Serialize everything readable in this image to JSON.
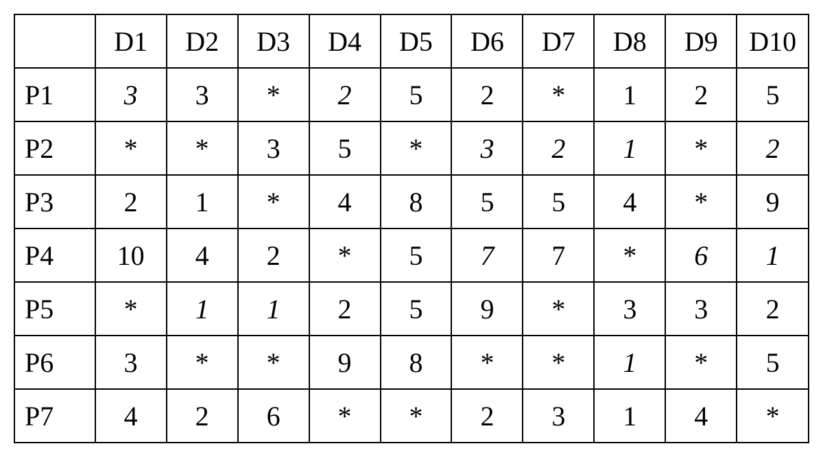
{
  "chart_data": {
    "type": "table",
    "columns": [
      "",
      "D1",
      "D2",
      "D3",
      "D4",
      "D5",
      "D6",
      "D7",
      "D8",
      "D9",
      "D10"
    ],
    "rows": [
      {
        "label": "P1",
        "cells": [
          {
            "v": "3",
            "italic": true
          },
          {
            "v": "3",
            "italic": false
          },
          {
            "v": "*",
            "italic": false
          },
          {
            "v": "2",
            "italic": true
          },
          {
            "v": "5",
            "italic": false
          },
          {
            "v": "2",
            "italic": false
          },
          {
            "v": "*",
            "italic": false
          },
          {
            "v": "1",
            "italic": false
          },
          {
            "v": "2",
            "italic": false
          },
          {
            "v": "5",
            "italic": false
          }
        ]
      },
      {
        "label": "P2",
        "cells": [
          {
            "v": "*",
            "italic": false
          },
          {
            "v": "*",
            "italic": false
          },
          {
            "v": "3",
            "italic": false
          },
          {
            "v": "5",
            "italic": false
          },
          {
            "v": "*",
            "italic": false
          },
          {
            "v": "3",
            "italic": true
          },
          {
            "v": "2",
            "italic": true
          },
          {
            "v": "1",
            "italic": true
          },
          {
            "v": "*",
            "italic": false
          },
          {
            "v": "2",
            "italic": true
          }
        ]
      },
      {
        "label": "P3",
        "cells": [
          {
            "v": "2",
            "italic": false
          },
          {
            "v": "1",
            "italic": false
          },
          {
            "v": "*",
            "italic": false
          },
          {
            "v": "4",
            "italic": false
          },
          {
            "v": "8",
            "italic": false
          },
          {
            "v": "5",
            "italic": false
          },
          {
            "v": "5",
            "italic": false
          },
          {
            "v": "4",
            "italic": false
          },
          {
            "v": "*",
            "italic": false
          },
          {
            "v": "9",
            "italic": false
          }
        ]
      },
      {
        "label": "P4",
        "cells": [
          {
            "v": "10",
            "italic": false
          },
          {
            "v": "4",
            "italic": false
          },
          {
            "v": "2",
            "italic": false
          },
          {
            "v": "*",
            "italic": false
          },
          {
            "v": "5",
            "italic": false
          },
          {
            "v": "7",
            "italic": true
          },
          {
            "v": "7",
            "italic": false
          },
          {
            "v": "*",
            "italic": false
          },
          {
            "v": "6",
            "italic": true
          },
          {
            "v": "1",
            "italic": true
          }
        ]
      },
      {
        "label": "P5",
        "cells": [
          {
            "v": "*",
            "italic": false
          },
          {
            "v": "1",
            "italic": true
          },
          {
            "v": "1",
            "italic": true
          },
          {
            "v": "2",
            "italic": false
          },
          {
            "v": "5",
            "italic": false
          },
          {
            "v": "9",
            "italic": false
          },
          {
            "v": "*",
            "italic": false
          },
          {
            "v": "3",
            "italic": false
          },
          {
            "v": "3",
            "italic": false
          },
          {
            "v": "2",
            "italic": false
          }
        ]
      },
      {
        "label": "P6",
        "cells": [
          {
            "v": "3",
            "italic": false
          },
          {
            "v": "*",
            "italic": false
          },
          {
            "v": "*",
            "italic": false
          },
          {
            "v": "9",
            "italic": false
          },
          {
            "v": "8",
            "italic": false
          },
          {
            "v": "*",
            "italic": false
          },
          {
            "v": "*",
            "italic": false
          },
          {
            "v": "1",
            "italic": true
          },
          {
            "v": "*",
            "italic": false
          },
          {
            "v": "5",
            "italic": false
          }
        ]
      },
      {
        "label": "P7",
        "cells": [
          {
            "v": "4",
            "italic": false
          },
          {
            "v": "2",
            "italic": false
          },
          {
            "v": "6",
            "italic": false
          },
          {
            "v": "*",
            "italic": false
          },
          {
            "v": "*",
            "italic": false
          },
          {
            "v": "2",
            "italic": false
          },
          {
            "v": "3",
            "italic": false
          },
          {
            "v": "1",
            "italic": false
          },
          {
            "v": "4",
            "italic": false
          },
          {
            "v": "*",
            "italic": false
          }
        ]
      }
    ]
  }
}
